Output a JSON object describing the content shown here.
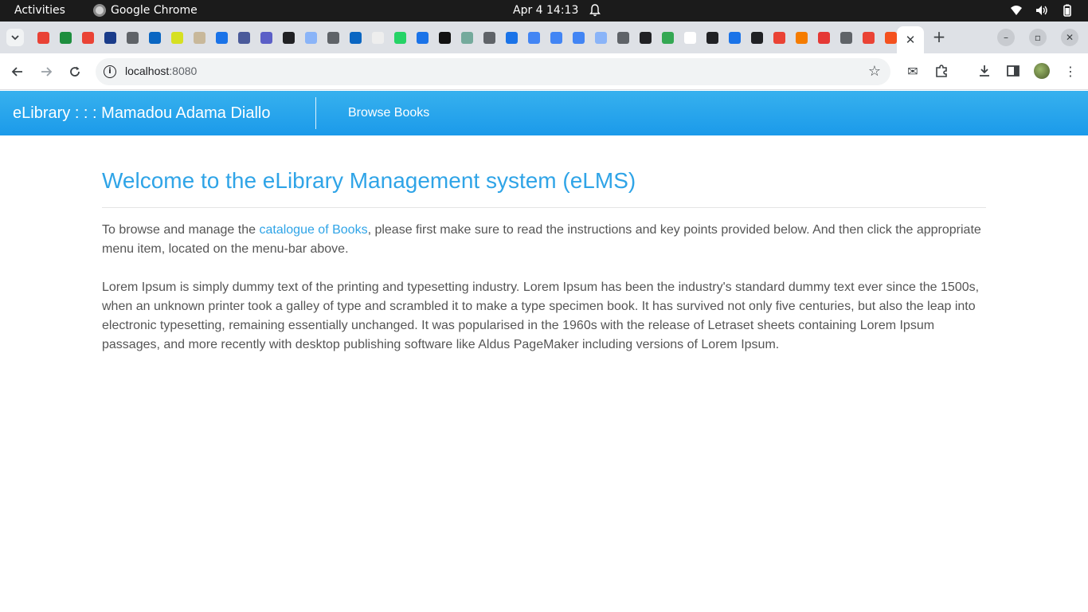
{
  "os_bar": {
    "activities": "Activities",
    "app_name": "Google Chrome",
    "clock": "Apr 4  14:13"
  },
  "browser": {
    "url_host": "localhost",
    "url_port": ":8080",
    "pinned_tab_colors": [
      "#e94235",
      "#1e8e3e",
      "#ea4335",
      "#1a3c8a",
      "#5f6368",
      "#0a66c2",
      "#d6e021",
      "#c8b89a",
      "#1a73e8",
      "#4a5a9a",
      "#5b5fc7",
      "#202124",
      "#8ab4f8",
      "#5f6368",
      "#0a66c2",
      "#eeeeee",
      "#25d366",
      "#1a73e8",
      "#111111",
      "#74aa9c",
      "#5f6368",
      "#1a73e8",
      "#4285f4",
      "#4285f4",
      "#4285f4",
      "#8ab4f8",
      "#5f6368",
      "#202124",
      "#34a853",
      "#ffffff",
      "#202124",
      "#1a73e8",
      "#202124",
      "#ea4335",
      "#f57c00",
      "#e53935",
      "#5f6368",
      "#ea4335",
      "#f4511e"
    ]
  },
  "app": {
    "brand": "eLibrary : : : Mamadou Adama Diallo",
    "nav_browse_books": "Browse Books"
  },
  "page": {
    "title": "Welcome to the eLibrary Management system (eLMS)",
    "intro_before_link": "To browse and manage the ",
    "intro_link": "catalogue of Books",
    "intro_after_link": ", please first make sure to read the instructions and key points provided below. And then click the appropriate menu item, located on the menu-bar above.",
    "lorem": "Lorem Ipsum is simply dummy text of the printing and typesetting industry. Lorem Ipsum has been the industry's standard dummy text ever since the 1500s, when an unknown printer took a galley of type and scrambled it to make a type specimen book. It has survived not only five centuries, but also the leap into electronic typesetting, remaining essentially unchanged. It was popularised in the 1960s with the release of Letraset sheets containing Lorem Ipsum passages, and more recently with desktop publishing software like Aldus PageMaker including versions of Lorem Ipsum."
  },
  "colors": {
    "navbar": "#2fa4e7",
    "link": "#2fa4e7",
    "body_text": "#555555"
  }
}
